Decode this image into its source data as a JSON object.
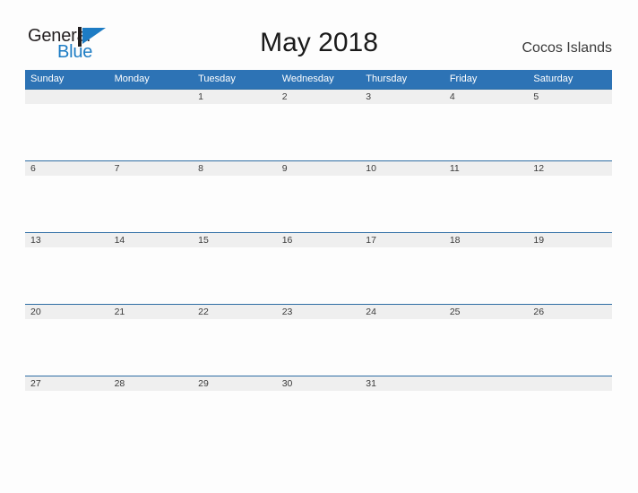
{
  "brand": {
    "name_part1": "General",
    "name_part2": "Blue",
    "mark": "flag-triangle-icon",
    "accent_color": "#1d7cc4"
  },
  "header": {
    "title": "May 2018",
    "location": "Cocos Islands"
  },
  "calendar": {
    "month": "May",
    "year": "2018",
    "header_color": "#2d73b5",
    "row_band_color": "#efefef",
    "row_border_color": "#2e6da4",
    "weekdays": [
      "Sunday",
      "Monday",
      "Tuesday",
      "Wednesday",
      "Thursday",
      "Friday",
      "Saturday"
    ],
    "weeks": [
      [
        "",
        "",
        "1",
        "2",
        "3",
        "4",
        "5"
      ],
      [
        "6",
        "7",
        "8",
        "9",
        "10",
        "11",
        "12"
      ],
      [
        "13",
        "14",
        "15",
        "16",
        "17",
        "18",
        "19"
      ],
      [
        "20",
        "21",
        "22",
        "23",
        "24",
        "25",
        "26"
      ],
      [
        "27",
        "28",
        "29",
        "30",
        "31",
        "",
        ""
      ]
    ]
  }
}
